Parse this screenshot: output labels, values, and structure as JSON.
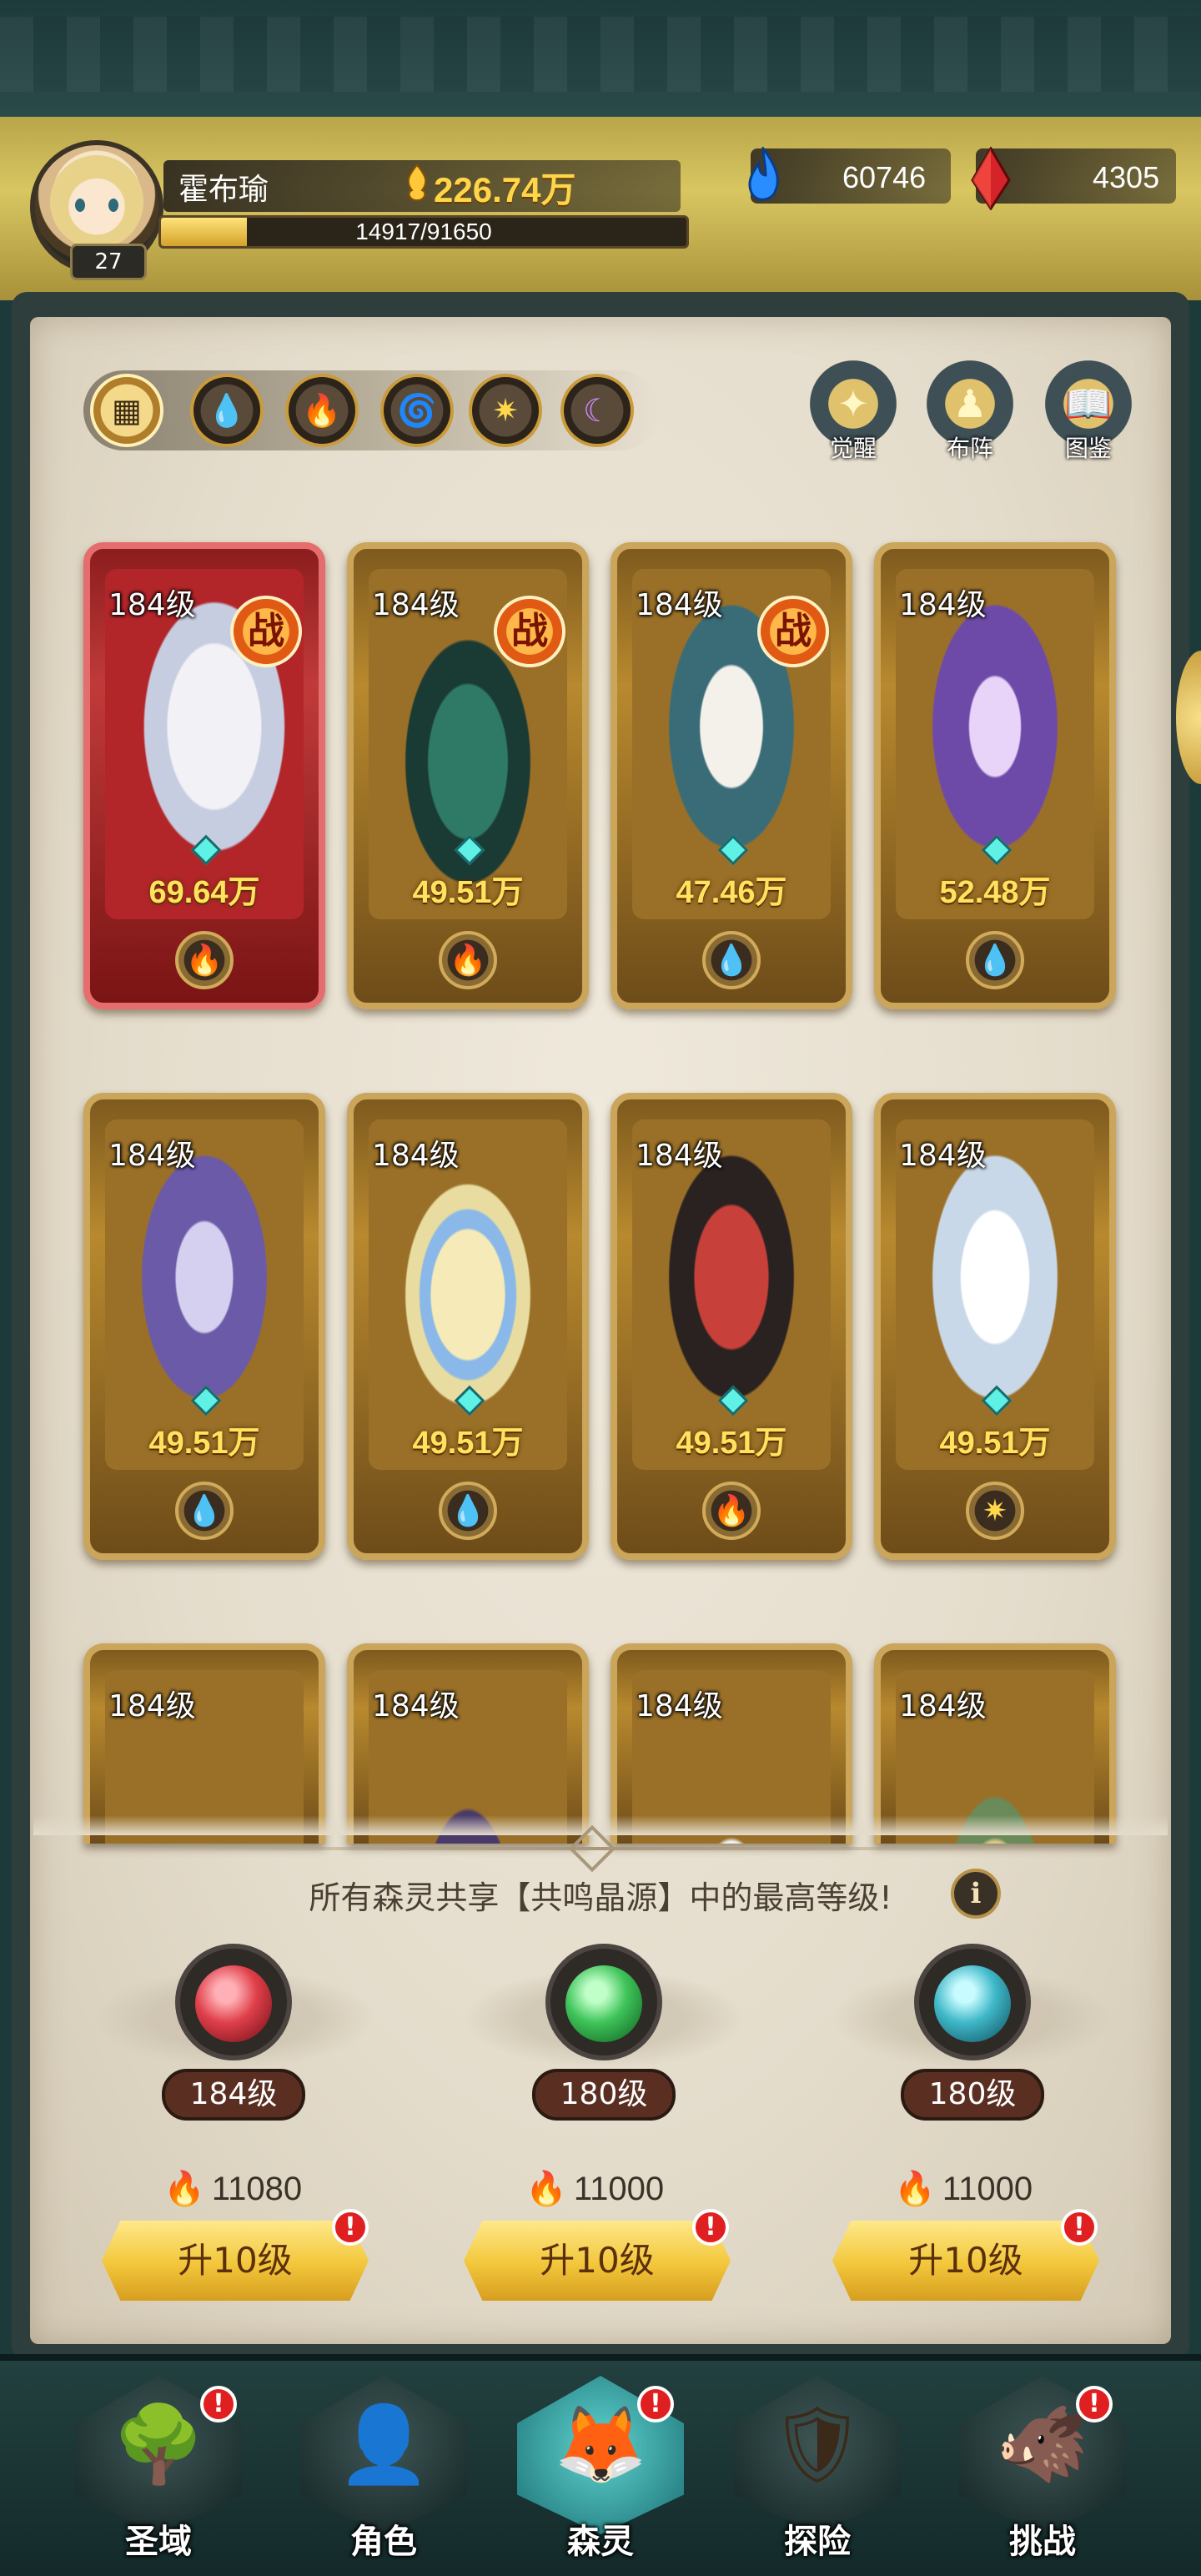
{
  "player": {
    "name": "霍布瑜",
    "level": "27",
    "gold": "226.74万",
    "exp": "14917/91650",
    "exp_fraction": 0.163
  },
  "resources": {
    "water": "60746",
    "fire_crystal": "4305"
  },
  "filters": [
    "all",
    "water",
    "fire",
    "wind",
    "light",
    "dark"
  ],
  "actions": {
    "awaken": "觉醒",
    "formation": "布阵",
    "codex": "图鉴"
  },
  "cards": [
    {
      "level": "184级",
      "power": "69.64万",
      "battle": "战",
      "element": "fire"
    },
    {
      "level": "184级",
      "power": "49.51万",
      "battle": "战",
      "element": "fire"
    },
    {
      "level": "184级",
      "power": "47.46万",
      "battle": "战",
      "element": "water"
    },
    {
      "level": "184级",
      "power": "52.48万",
      "element": "water"
    },
    {
      "level": "184级",
      "power": "49.51万",
      "element": "water"
    },
    {
      "level": "184级",
      "power": "49.51万",
      "element": "water"
    },
    {
      "level": "184级",
      "power": "49.51万",
      "element": "fire"
    },
    {
      "level": "184级",
      "power": "49.51万",
      "element": "light"
    },
    {
      "level": "184级"
    },
    {
      "level": "184级"
    },
    {
      "level": "184级"
    },
    {
      "level": "184级"
    }
  ],
  "resonance": {
    "shared_text": "所有森灵共享【共鸣晶源】中的最高等级!",
    "info_label": "i",
    "crystals": [
      {
        "level": "184级",
        "cost": "11080",
        "button": "升10级",
        "badge": "!",
        "color": "#e0404a"
      },
      {
        "level": "180级",
        "cost": "11000",
        "button": "升10级",
        "badge": "!",
        "color": "#3fc45a"
      },
      {
        "level": "180级",
        "cost": "11000",
        "button": "升10级",
        "badge": "!",
        "color": "#3fb8c8"
      }
    ]
  },
  "nav": [
    {
      "label": "圣域",
      "badge": "!"
    },
    {
      "label": "角色"
    },
    {
      "label": "森灵",
      "badge": "!",
      "active": true
    },
    {
      "label": "探险"
    },
    {
      "label": "挑战",
      "badge": "!"
    }
  ]
}
